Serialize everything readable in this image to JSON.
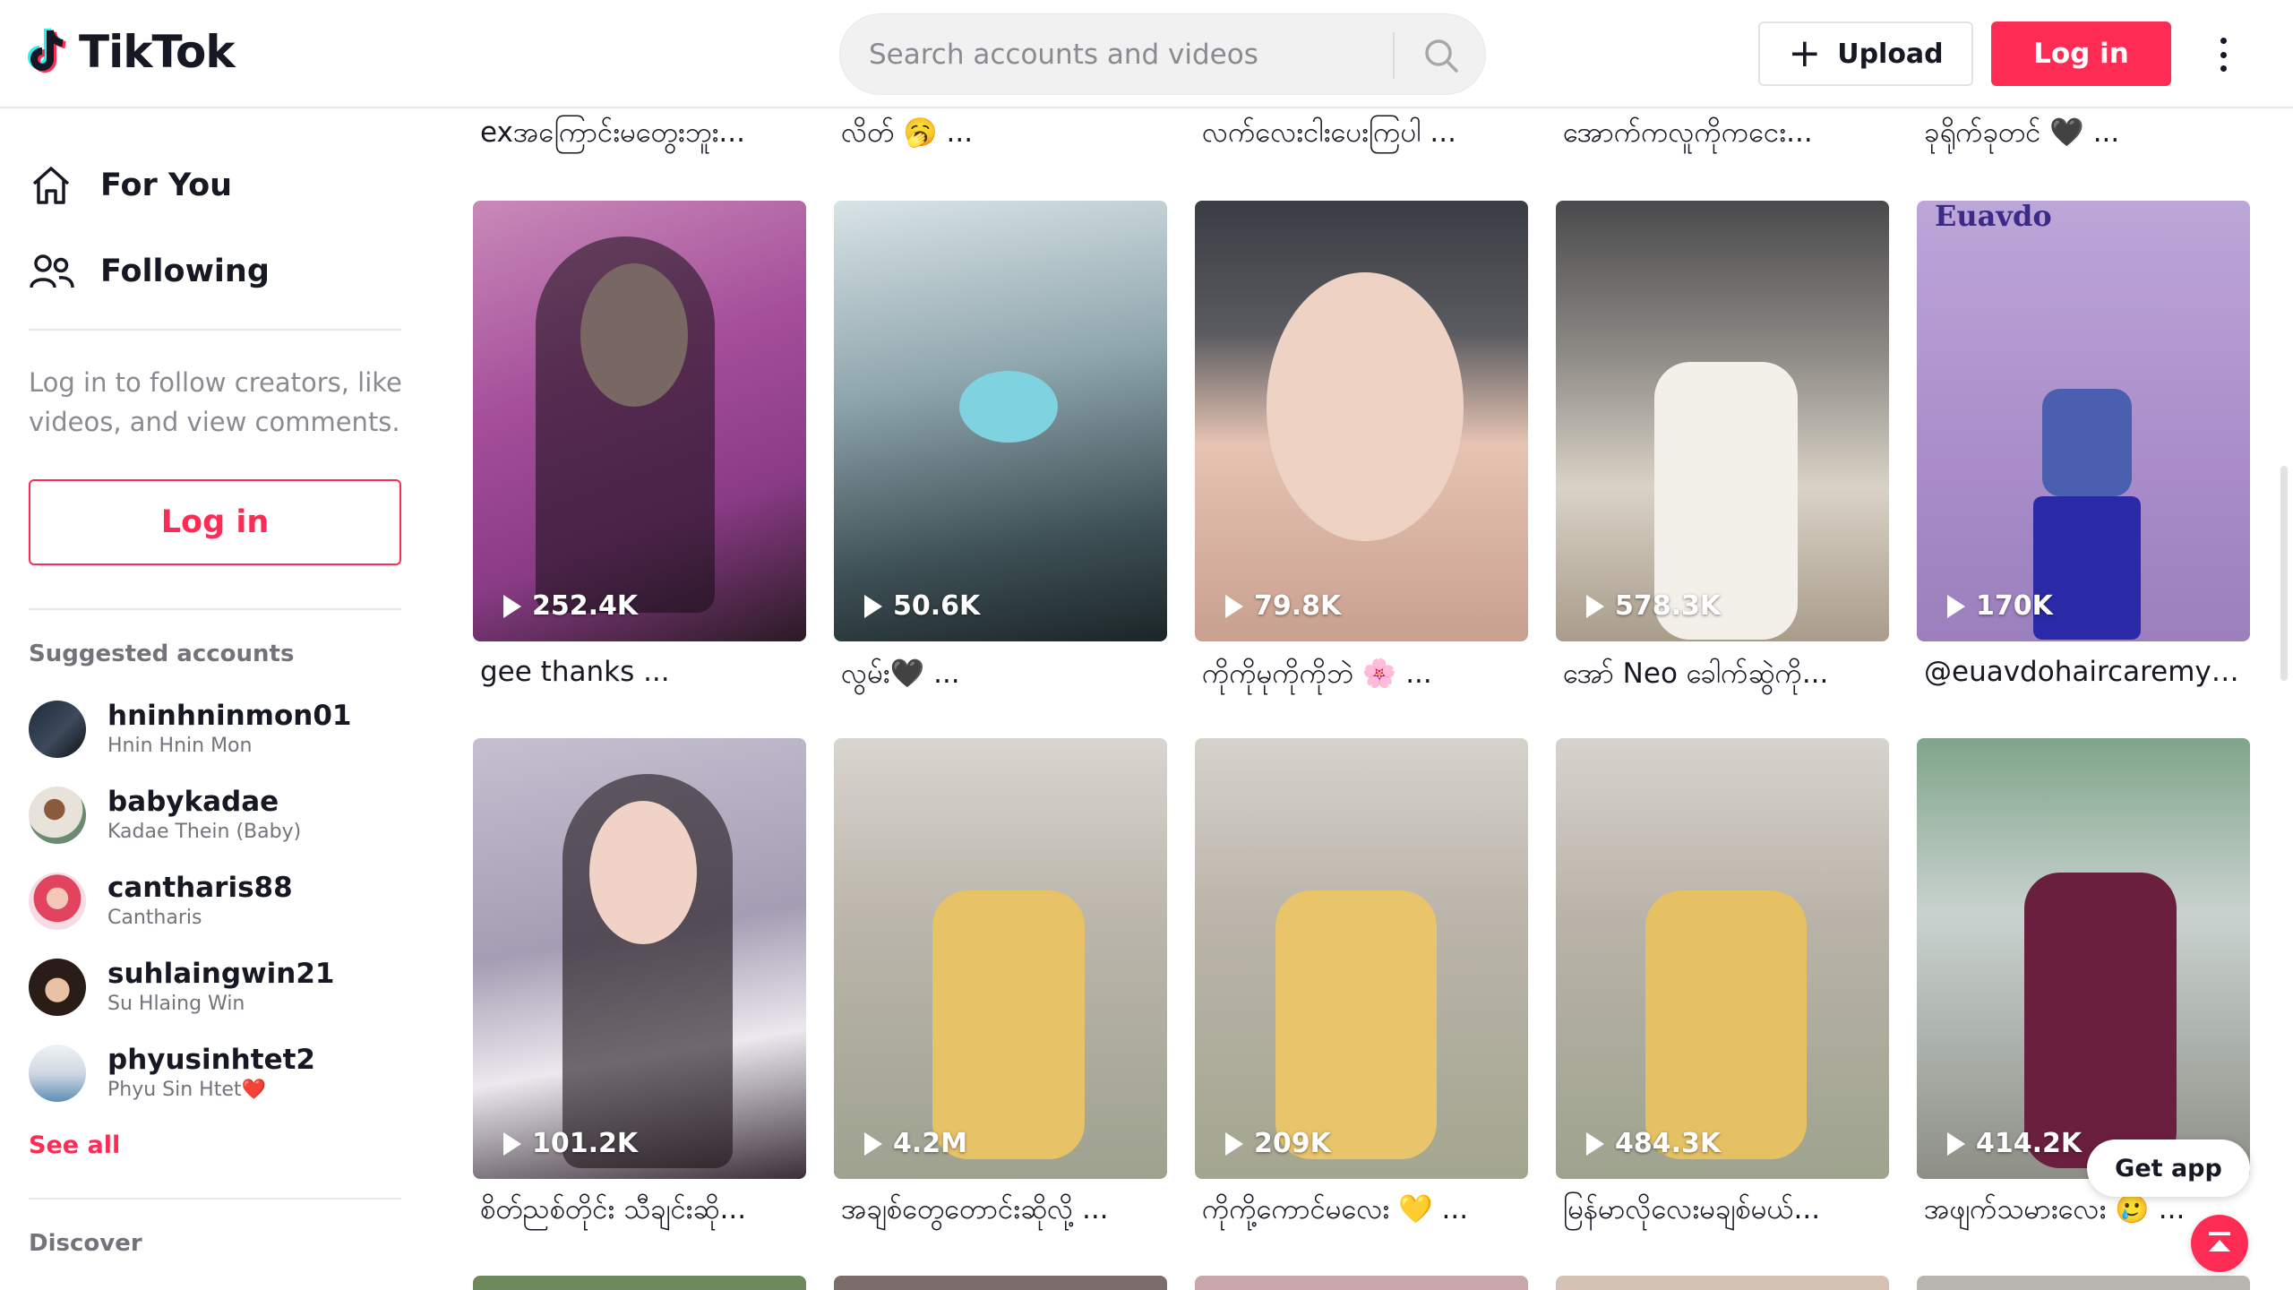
{
  "header": {
    "logo_text": "TikTok",
    "search_placeholder": "Search accounts and videos",
    "upload_label": "Upload",
    "login_label": "Log in"
  },
  "sidebar": {
    "nav": [
      {
        "label": "For You",
        "icon": "home-icon"
      },
      {
        "label": "Following",
        "icon": "people-icon"
      }
    ],
    "prompt": "Log in to follow creators, like videos, and view comments.",
    "login_label": "Log in",
    "suggested_title": "Suggested accounts",
    "accounts": [
      {
        "username": "hninhninmon01",
        "display_name": "Hnin Hnin Mon"
      },
      {
        "username": "babykadae",
        "display_name": "Kadae Thein (Baby)"
      },
      {
        "username": "cantharis88",
        "display_name": "Cantharis"
      },
      {
        "username": "suhlaingwin21",
        "display_name": "Su Hlaing Win"
      },
      {
        "username": "phyusinhtet2",
        "display_name": "Phyu Sin Htet❤️"
      }
    ],
    "see_all": "See all",
    "discover_title": "Discover"
  },
  "top_captions": [
    "exအကြောင်းမတွေးဘူး...",
    "လိတ် 🥱 ...",
    "လက်လေးငါးပေးကြပါ ...",
    "အောက်ကလူကိုကငေး...",
    "ခုရိုက်ခုတင် 🖤 ..."
  ],
  "row1": [
    {
      "views": "252.4K",
      "caption": "gee thanks ..."
    },
    {
      "views": "50.6K",
      "caption": "လွမ်း🖤 ..."
    },
    {
      "views": "79.8K",
      "caption": "ကိုကိုမုကိုကိုဘဲ 🌸 ..."
    },
    {
      "views": "578.3K",
      "caption": "အော် Neo ခေါက်ဆွဲကို..."
    },
    {
      "views": "170K",
      "caption": "@euavdohaircaremyan...",
      "overlay": "Euavdo"
    }
  ],
  "row2": [
    {
      "views": "101.2K",
      "caption": "စိတ်ညစ်တိုင်း သီချင်းဆို..."
    },
    {
      "views": "4.2M",
      "caption": "အချစ်တွေတောင်းဆိုလို့ ..."
    },
    {
      "views": "209K",
      "caption": "ကိုကို့ကောင်မလေး 💛 ..."
    },
    {
      "views": "484.3K",
      "caption": "မြန်မာလိုလေးမချစ်မယ်..."
    },
    {
      "views": "414.2K",
      "caption": "အဖျက်သမားလေး 🥲 ..."
    }
  ],
  "floating": {
    "get_app": "Get app"
  },
  "colors": {
    "brand": "#fe2c55",
    "text": "#161823",
    "muted": "#8a8b91"
  }
}
